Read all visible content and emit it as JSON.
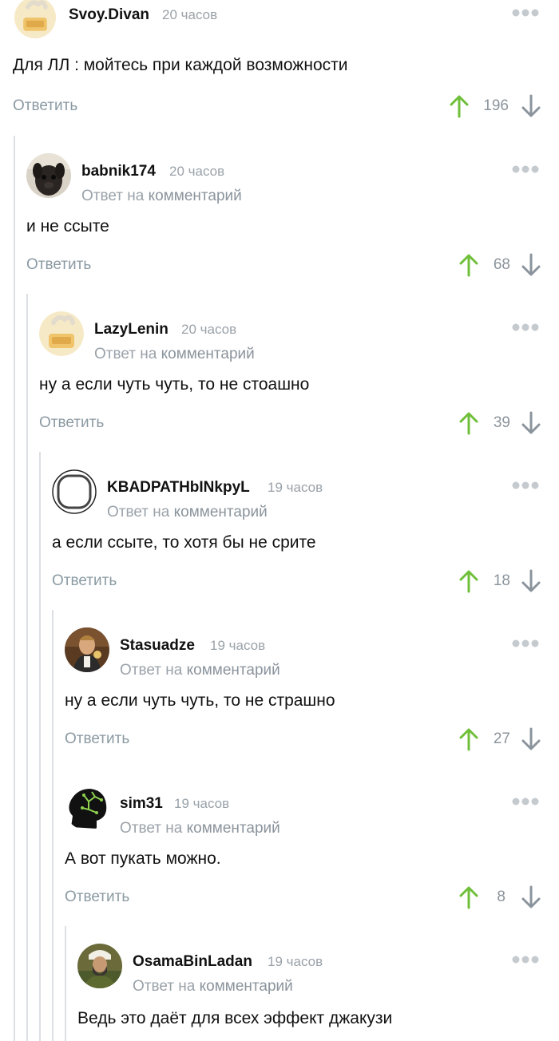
{
  "thread": {
    "comments": [
      {
        "author": "Svoy.Divan",
        "time": "20 часов",
        "reply_prefix": "",
        "reply_link": "",
        "text": "Для ЛЛ : мойтесь при каждой возможности",
        "reply_label": "Ответить",
        "score": "196",
        "avatar": "smoking-sofa-icon"
      },
      {
        "author": "babnik174",
        "time": "20 часов",
        "reply_prefix": "Ответ на",
        "reply_link": "комментарий",
        "text": "и не ссыте",
        "reply_label": "Ответить",
        "score": "68",
        "avatar": "dog-photo"
      },
      {
        "author": "LazyLenin",
        "time": "20 часов",
        "reply_prefix": "Ответ на",
        "reply_link": "комментарий",
        "text": "ну а если чуть чуть, то не стоашно",
        "reply_label": "Ответить",
        "score": "39",
        "avatar": "smoking-sofa-icon"
      },
      {
        "author": "KBADPATHbINkpyL",
        "time": "19 часов",
        "reply_prefix": "Ответ на",
        "reply_link": "комментарий",
        "text": "а если ссыте, то хотя бы не срите",
        "reply_label": "Ответить",
        "score": "18",
        "avatar": "rounded-square-outline"
      },
      {
        "author": "Stasuadze",
        "time": "19 часов",
        "reply_prefix": "Ответ на",
        "reply_link": "комментарий",
        "text": "ну а если чуть чуть, то не страшно",
        "reply_label": "Ответить",
        "score": "27",
        "avatar": "man-toasting-photo"
      },
      {
        "author": "sim31",
        "time": "19 часов",
        "reply_prefix": "Ответ на",
        "reply_link": "комментарий",
        "text": "А вот пукать можно.",
        "reply_label": "Ответить",
        "score": "8",
        "avatar": "circuit-head-icon"
      },
      {
        "author": "OsamaBinLadan",
        "time": "19 часов",
        "reply_prefix": "Ответ на",
        "reply_link": "комментарий",
        "text": "Ведь это даёт для всех эффект джакузи",
        "reply_label": "",
        "score": "",
        "avatar": "bearded-man-photo"
      }
    ]
  },
  "colors": {
    "upvote": "#6fbf3a",
    "downvote": "#8b949c",
    "muted": "#9aa2a9",
    "thread_line": "#dcdfe3"
  }
}
